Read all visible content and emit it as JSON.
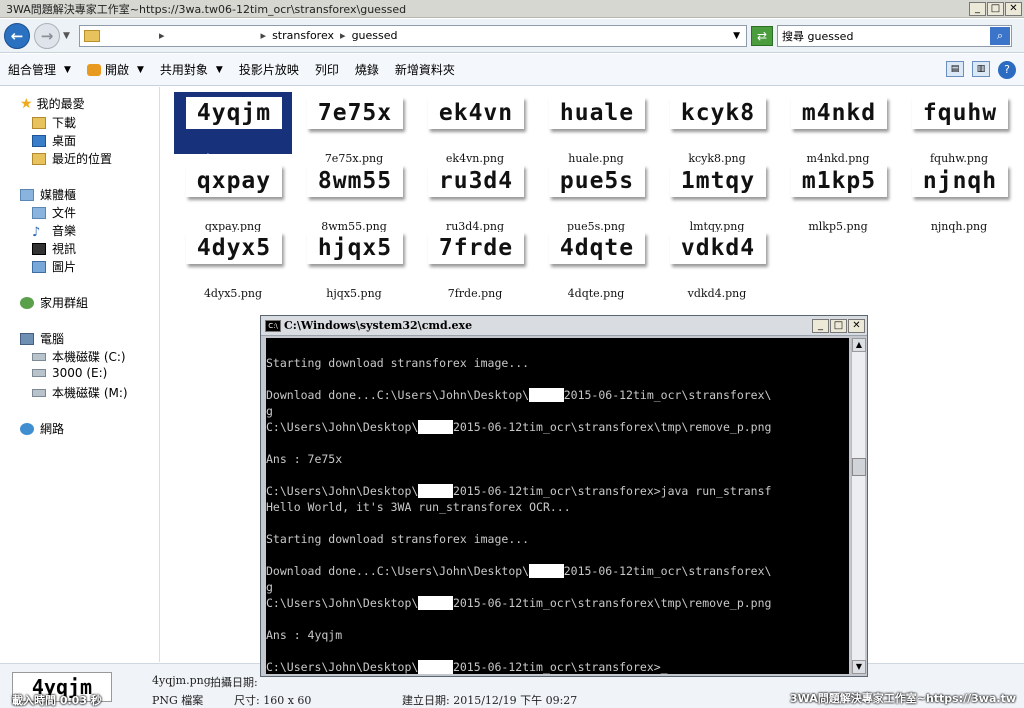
{
  "window": {
    "title": "3WA問題解決專家工作室~https://3wa.tw06-12tim_ocr\\stransforex\\guessed"
  },
  "address": {
    "crumbs": [
      "stransforex",
      "guessed"
    ],
    "search_placeholder": "搜尋 guessed"
  },
  "toolbar": {
    "items": [
      "組合管理",
      "開啟",
      "共用對象",
      "投影片放映",
      "列印",
      "燒錄",
      "新增資料夾"
    ]
  },
  "navpane": {
    "favorites": "我的最愛",
    "fav_items": [
      "下載",
      "桌面",
      "最近的位置"
    ],
    "libraries": "媒體櫃",
    "lib_items": [
      "文件",
      "音樂",
      "視訊",
      "圖片"
    ],
    "homegroup": "家用群組",
    "computer": "電腦",
    "drives": [
      "本機磁碟 (C:)",
      "3000 (E:)",
      "本機磁碟 (M:)"
    ],
    "network": "網路"
  },
  "files": [
    {
      "text": "4yqjm",
      "name": "4yqjm.png",
      "selected": true
    },
    {
      "text": "7e75x",
      "name": "7e75x.png"
    },
    {
      "text": "ek4vn",
      "name": "ek4vn.png"
    },
    {
      "text": "huale",
      "name": "huale.png"
    },
    {
      "text": "kcyk8",
      "name": "kcyk8.png"
    },
    {
      "text": "m4nkd",
      "name": "m4nkd.png"
    },
    {
      "text": "fquhw",
      "name": "fquhw.png"
    },
    {
      "text": "qxpay",
      "name": "qxpay.png"
    },
    {
      "text": "8wm55",
      "name": "8wm55.png"
    },
    {
      "text": "ru3d4",
      "name": "ru3d4.png"
    },
    {
      "text": "pue5s",
      "name": "pue5s.png"
    },
    {
      "text": "1mtqy",
      "name": "lmtqy.png"
    },
    {
      "text": "m1kp5",
      "name": "mlkp5.png"
    },
    {
      "text": "njnqh",
      "name": "njnqh.png"
    },
    {
      "text": "4dyx5",
      "name": "4dyx5.png"
    },
    {
      "text": "hjqx5",
      "name": "hjqx5.png"
    },
    {
      "text": "7frde",
      "name": "7frde.png"
    },
    {
      "text": "4dqte",
      "name": "4dqte.png"
    },
    {
      "text": "vdkd4",
      "name": "vdkd4.png"
    }
  ],
  "cmd": {
    "title": "C:\\Windows\\system32\\cmd.exe",
    "lines": [
      {
        "a": "Starting download stransforex image..."
      },
      {
        "a": "Download done...C:\\Users\\John\\Desktop\\",
        "r": "     ",
        "b": "2015-06-12tim_ocr\\stransforex\\"
      },
      {
        "a": "g"
      },
      {
        "a": "C:\\Users\\John\\Desktop\\",
        "r": "     ",
        "b": "2015-06-12tim_ocr\\stransforex\\tmp\\remove_p.png"
      },
      {
        "a": "Ans : 7e75x"
      },
      {
        "a": "C:\\Users\\John\\Desktop\\",
        "r": "     ",
        "b": "2015-06-12tim_ocr\\stransforex>java run_stransf"
      },
      {
        "a": "Hello World, it's 3WA run_stransforex OCR..."
      },
      {
        "a": "Starting download stransforex image..."
      },
      {
        "a": "Download done...C:\\Users\\John\\Desktop\\",
        "r": "     ",
        "b": "2015-06-12tim_ocr\\stransforex\\"
      },
      {
        "a": "g"
      },
      {
        "a": "C:\\Users\\John\\Desktop\\",
        "r": "     ",
        "b": "2015-06-12tim_ocr\\stransforex\\tmp\\remove_p.png"
      },
      {
        "a": "Ans : 4yqjm"
      },
      {
        "a": "C:\\Users\\John\\Desktop\\",
        "r": "     ",
        "b": "2015-06-12tim_ocr\\stransforex>_"
      }
    ]
  },
  "details": {
    "preview": "4yqjm",
    "filename": "4yqjm.png",
    "shot_label": "拍攝日期:",
    "type": "PNG 檔案",
    "size": "尺寸: 160 x 60",
    "created": "建立日期: 2015/12/19 下午 09:27",
    "load": "載入時間 0.03 秒"
  },
  "watermark": "3WA問題解決專家工作室~https://3wa.tw"
}
